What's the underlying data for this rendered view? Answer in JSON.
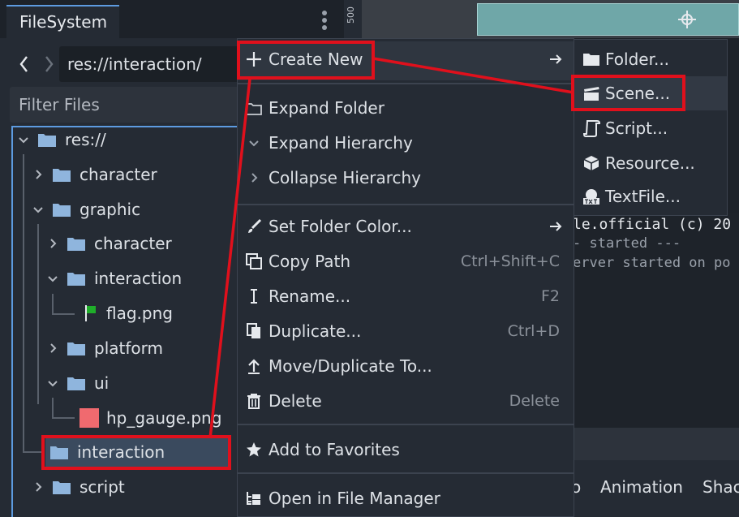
{
  "filesystem": {
    "tab_title": "FileSystem",
    "path": "res://interaction/",
    "filter_placeholder": "Filter Files",
    "ruler_label": "500",
    "tree": [
      {
        "label": "res://",
        "icon": "folder-icon"
      },
      {
        "label": "character",
        "icon": "folder-icon"
      },
      {
        "label": "graphic",
        "icon": "folder-icon"
      },
      {
        "label": "character",
        "icon": "folder-icon"
      },
      {
        "label": "interaction",
        "icon": "folder-icon"
      },
      {
        "label": "flag.png",
        "icon": "flag-icon"
      },
      {
        "label": "platform",
        "icon": "folder-icon"
      },
      {
        "label": "ui",
        "icon": "folder-icon"
      },
      {
        "label": "hp_gauge.png",
        "icon": "image-icon"
      },
      {
        "label": "interaction",
        "icon": "folder-icon"
      },
      {
        "label": "script",
        "icon": "folder-icon"
      }
    ]
  },
  "context_menu": {
    "items": [
      {
        "label": "Create New",
        "icon": "plus-icon"
      },
      {
        "label": "Expand Folder",
        "icon": "folder-open-icon"
      },
      {
        "label": "Expand Hierarchy",
        "icon": "chevron-down-icon"
      },
      {
        "label": "Collapse Hierarchy",
        "icon": "chevron-right-icon"
      },
      {
        "label": "Set Folder Color...",
        "icon": "brush-icon"
      },
      {
        "label": "Copy Path",
        "icon": "copy-icon",
        "shortcut": "Ctrl+Shift+C"
      },
      {
        "label": "Rename...",
        "icon": "rename-icon",
        "shortcut": "F2"
      },
      {
        "label": "Duplicate...",
        "icon": "duplicate-icon",
        "shortcut": "Ctrl+D"
      },
      {
        "label": "Move/Duplicate To...",
        "icon": "move-icon"
      },
      {
        "label": "Delete",
        "icon": "trash-icon",
        "shortcut": "Delete"
      },
      {
        "label": "Add to Favorites",
        "icon": "star-icon"
      },
      {
        "label": "Open in File Manager",
        "icon": "file-manager-icon"
      }
    ]
  },
  "submenu": {
    "items": [
      {
        "label": "Folder...",
        "icon": "folder-icon"
      },
      {
        "label": "Scene...",
        "icon": "clapperboard-icon"
      },
      {
        "label": "Script...",
        "icon": "script-icon"
      },
      {
        "label": "Resource...",
        "icon": "cube-icon"
      },
      {
        "label": "TextFile...",
        "icon": "textfile-icon"
      }
    ]
  },
  "output": {
    "lines": [
      "le.official (c) 20",
      "- started ---",
      "erver started on po"
    ]
  },
  "bottom_tabs": [
    "o",
    "Animation",
    "Shac"
  ],
  "colors": {
    "highlight": "#e0101c",
    "folder": "#8fb5dd",
    "menu_bg": "#252b34"
  }
}
